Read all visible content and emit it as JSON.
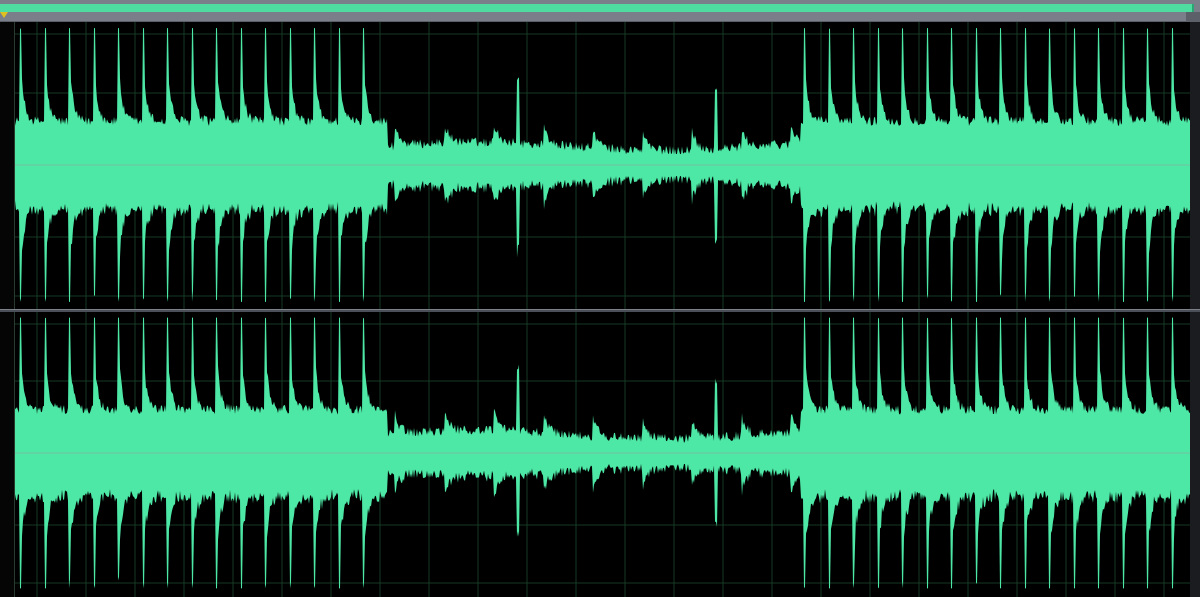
{
  "app": {
    "view": "stereo-waveform-editor",
    "channels": [
      {
        "id": "left",
        "label": ""
      },
      {
        "id": "right",
        "label": ""
      }
    ]
  },
  "colors": {
    "background": "#000000",
    "waveform": "#4de8a6",
    "grid": "#163a24",
    "center_line": "#9a9a9a",
    "overview_range": "#4fdca0",
    "overview_bar": "#7a7f8a",
    "playhead": "#e0c020"
  },
  "icons": {
    "playhead": "triangle-down-icon"
  }
}
